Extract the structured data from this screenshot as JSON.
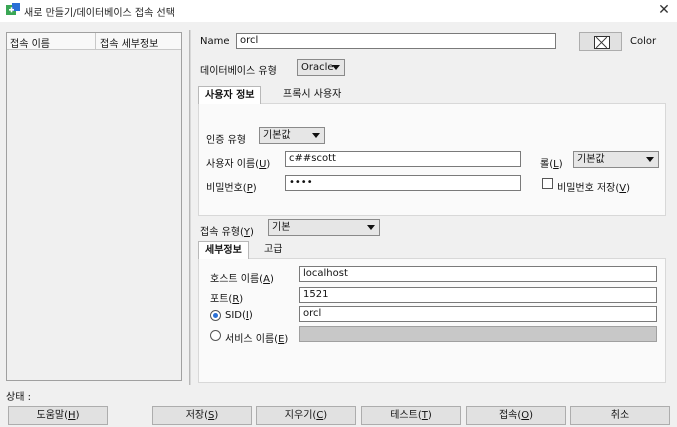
{
  "window": {
    "title": "새로 만들기/데이터베이스 접속 선택",
    "close_glyph": "✕"
  },
  "connection_list": {
    "col_name": "접속 이름",
    "col_detail": "접속 세부정보"
  },
  "name_label": "Name",
  "name_value": "orcl",
  "color_label": "Color",
  "db_type": {
    "label": "데이터베이스 유형",
    "value": "Oracle"
  },
  "top_tabs": [
    "사용자 정보",
    "프록시 사용자"
  ],
  "auth": {
    "label": "인증 유형",
    "value": "기본값"
  },
  "username": {
    "label": "사용자 이름(",
    "mnemonic": "U",
    "value": "c##scott"
  },
  "role": {
    "label": "롤(",
    "mnemonic": "L",
    "value": "기본값"
  },
  "password": {
    "label": "비밀번호(",
    "mnemonic": "P",
    "value": "••••"
  },
  "save_password": {
    "label": "비밀번호 저장(",
    "mnemonic": "V"
  },
  "conn_type": {
    "label": "접속 유형(",
    "mnemonic": "Y",
    "value": "기본"
  },
  "detail_tabs": [
    "세부정보",
    "고급"
  ],
  "host": {
    "label": "호스트 이름(",
    "mnemonic": "A",
    "value": "localhost"
  },
  "port": {
    "label": "포트(",
    "mnemonic": "R",
    "value": "1521"
  },
  "sid": {
    "label": "SID(",
    "mnemonic": "I",
    "value": "orcl"
  },
  "service": {
    "label": "서비스 이름(",
    "mnemonic": "E",
    "value": ""
  },
  "status_label": "상태 :",
  "buttons": {
    "help": {
      "label": "도움말(",
      "mnemonic": "H"
    },
    "save": {
      "label": "저장(",
      "mnemonic": "S"
    },
    "clear": {
      "label": "지우기(",
      "mnemonic": "C"
    },
    "test": {
      "label": "테스트(",
      "mnemonic": "T"
    },
    "connect": {
      "label": "접속(",
      "mnemonic": "O"
    },
    "cancel": {
      "label": "취소"
    }
  },
  "colors": {
    "accent": "#2a6fd6",
    "frame_bg": "#f0f0f0"
  }
}
